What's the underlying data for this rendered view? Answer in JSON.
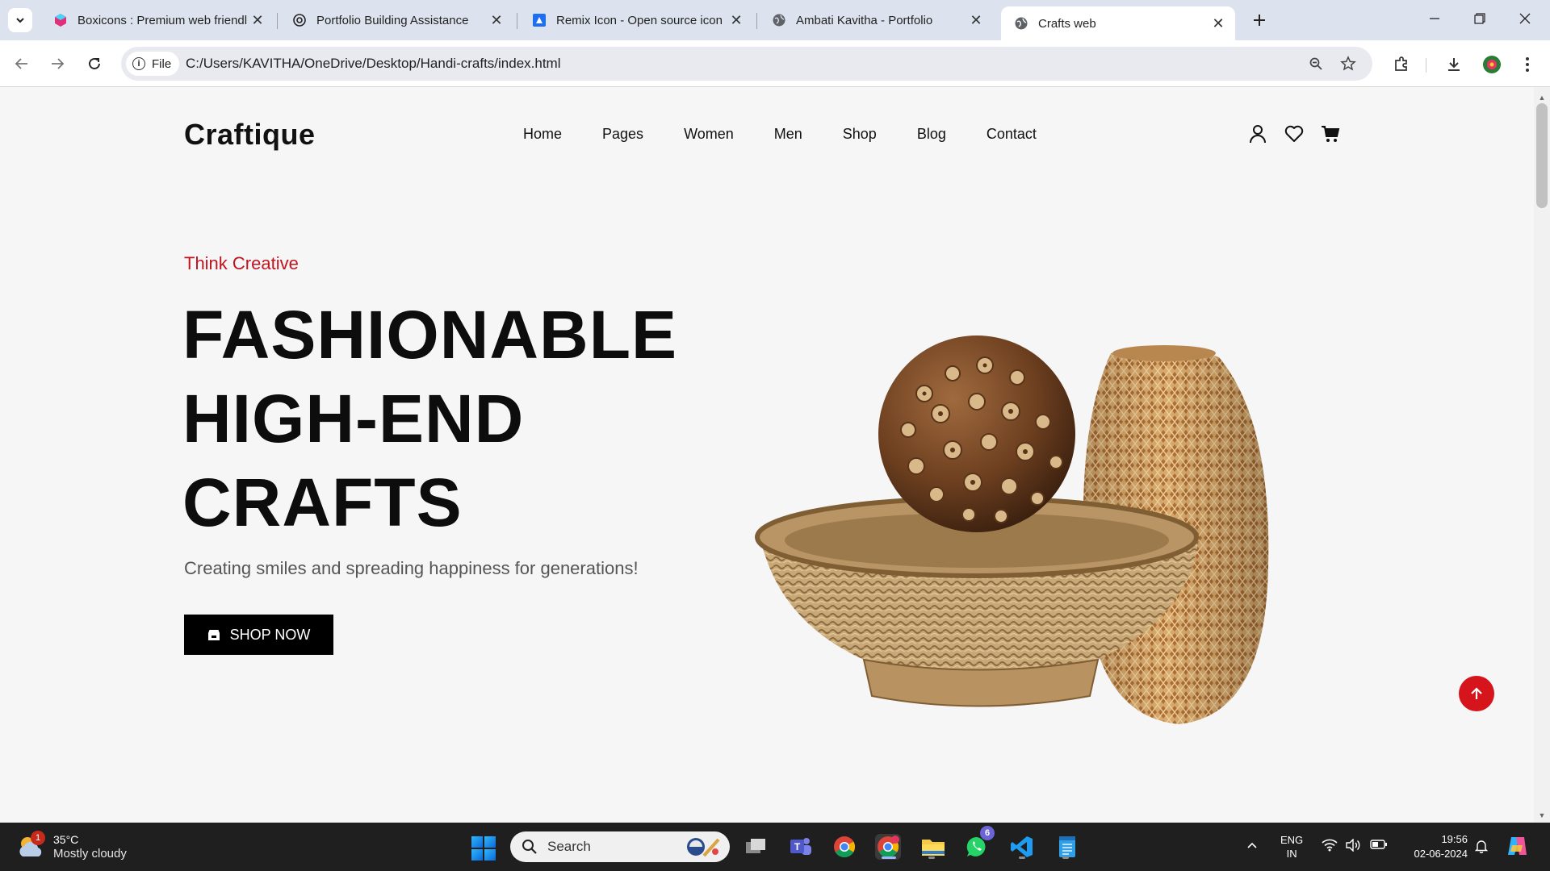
{
  "browser": {
    "tabs": [
      {
        "title": "Boxicons : Premium web friendl",
        "icon": "boxicons-favicon",
        "active": false
      },
      {
        "title": "Portfolio Building Assistance",
        "icon": "chatgpt-favicon",
        "active": false
      },
      {
        "title": "Remix Icon - Open source icon l",
        "icon": "remixicon-favicon",
        "active": false
      },
      {
        "title": "Ambati Kavitha - Portfolio",
        "icon": "globe-favicon",
        "active": false
      },
      {
        "title": "Crafts web",
        "icon": "globe-favicon",
        "active": true
      }
    ],
    "address_chip": "File",
    "url": "C:/Users/KAVITHA/OneDrive/Desktop/Handi-crafts/index.html"
  },
  "site": {
    "logo": "Craftique",
    "nav": [
      "Home",
      "Pages",
      "Women",
      "Men",
      "Shop",
      "Blog",
      "Contact"
    ],
    "hero": {
      "tagline": "Think Creative",
      "headline": [
        "FASHIONABLE",
        "HIGH-END",
        "CRAFTS"
      ],
      "subtitle": "Creating smiles and spreading happiness for generations!",
      "cta": "SHOP NOW"
    },
    "accent_color": "#c0141f"
  },
  "taskbar": {
    "weather": {
      "temp": "35°C",
      "condition": "Mostly cloudy",
      "badge": "1"
    },
    "search_placeholder": "Search",
    "whatsapp_badge": "6",
    "lang": [
      "ENG",
      "IN"
    ],
    "time": "19:56",
    "date": "02-06-2024"
  }
}
